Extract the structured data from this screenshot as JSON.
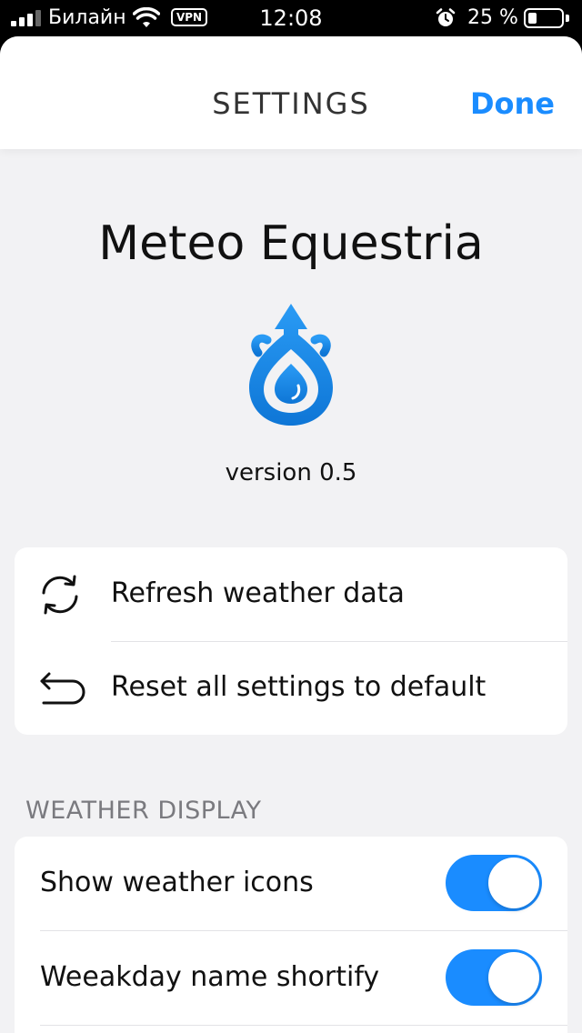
{
  "status_bar": {
    "carrier": "Билайн",
    "vpn_label": "VPN",
    "time": "12:08",
    "battery_percent": "25 %",
    "battery_level": 0.25,
    "signal_icon": "cellular-signal-icon",
    "wifi_icon": "wifi-icon",
    "alarm_icon": "alarm-clock-icon"
  },
  "nav": {
    "title": "SETTINGS",
    "done_label": "Done"
  },
  "about": {
    "app_name": "Meteo Equestria",
    "logo_icon": "water-drop-logo-icon",
    "version": "version 0.5"
  },
  "actions": [
    {
      "icon": "refresh-icon",
      "label": "Refresh weather data"
    },
    {
      "icon": "undo-arrow-icon",
      "label": "Reset all settings to default"
    }
  ],
  "weather_display": {
    "header": "WEATHER DISPLAY",
    "options": [
      {
        "label": "Show weather icons",
        "enabled": true
      },
      {
        "label": "Weeakday name shortify",
        "enabled": true
      }
    ]
  },
  "colors": {
    "accent": "#1a8cff",
    "background": "#f2f2f4",
    "card": "#ffffff",
    "section_header": "#7a7a7f"
  }
}
